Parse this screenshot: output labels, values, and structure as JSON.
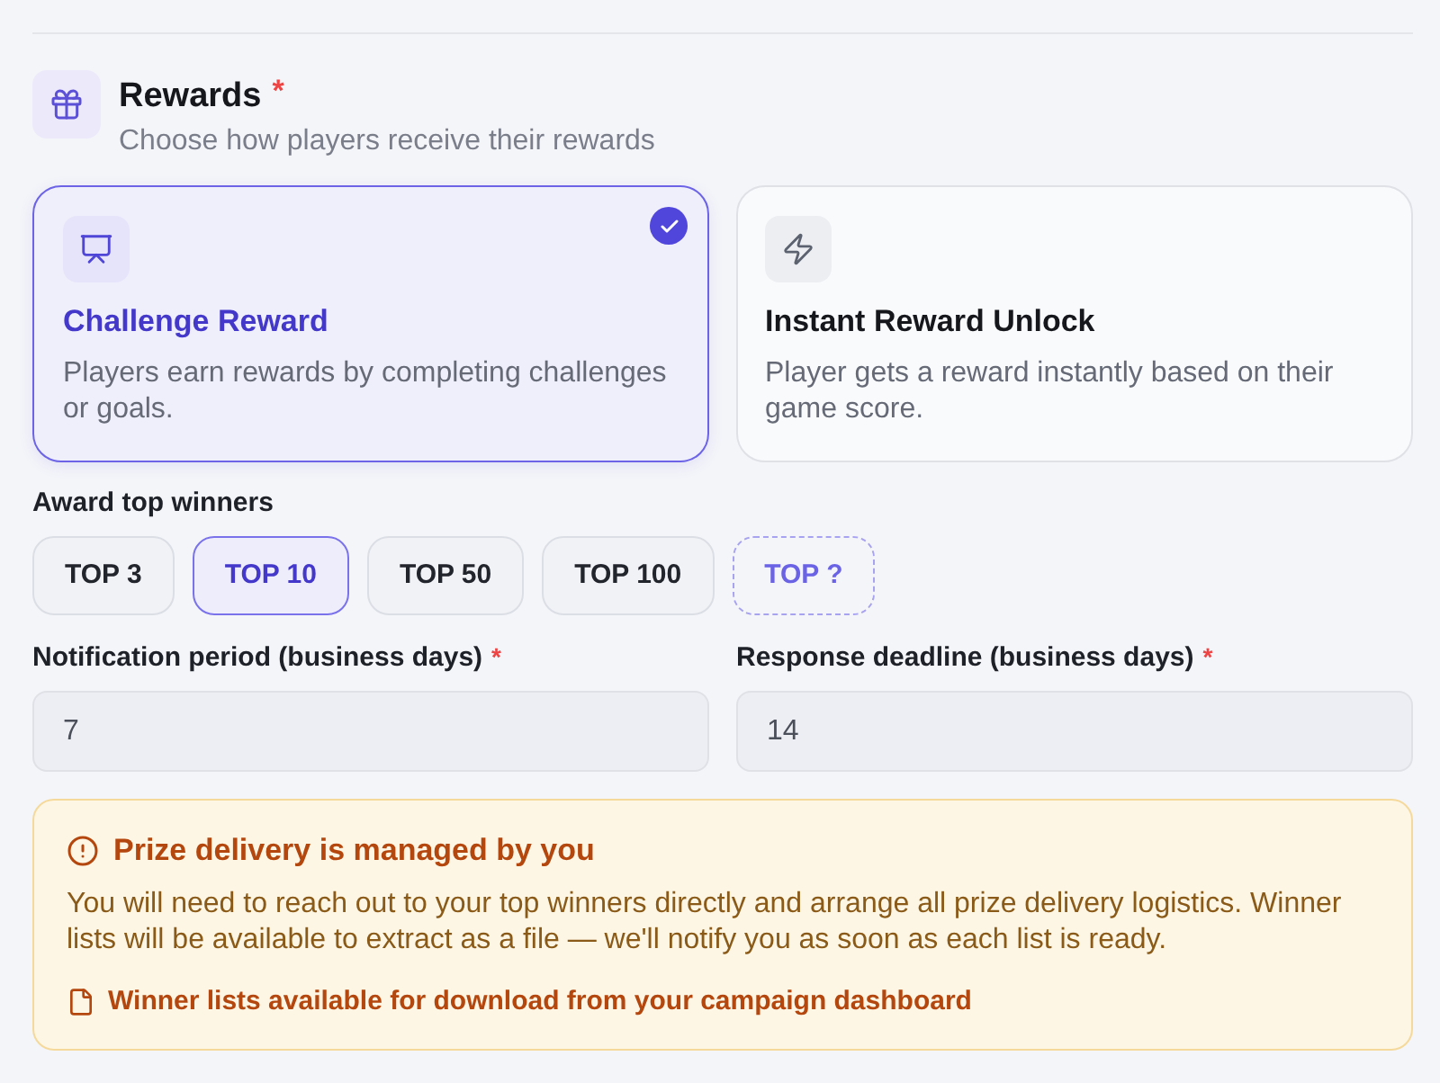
{
  "section": {
    "title": "Rewards",
    "required_mark": "*",
    "subtitle": "Choose how players receive their rewards"
  },
  "reward_types": [
    {
      "title": "Challenge Reward",
      "description": "Players earn rewards by completing challenges or goals.",
      "selected": true
    },
    {
      "title": "Instant Reward Unlock",
      "description": "Player gets a reward instantly based on their game score.",
      "selected": false
    }
  ],
  "award_top_winners": {
    "label": "Award top winners",
    "options": [
      {
        "label": "TOP 3",
        "kind": "preset",
        "selected": false
      },
      {
        "label": "TOP 10",
        "kind": "preset",
        "selected": true
      },
      {
        "label": "TOP 50",
        "kind": "preset",
        "selected": false
      },
      {
        "label": "TOP 100",
        "kind": "preset",
        "selected": false
      },
      {
        "label": "TOP ?",
        "kind": "custom",
        "selected": false
      }
    ]
  },
  "fields": [
    {
      "label": "Notification period (business days)",
      "required_mark": "*",
      "value": "7"
    },
    {
      "label": "Response deadline (business days)",
      "required_mark": "*",
      "value": "14"
    }
  ],
  "notice": {
    "title": "Prize delivery is managed by you",
    "body": "You will need to reach out to your top winners directly and arrange all prize delivery logistics. Winner lists will be available to extract as a file — we'll notify you as soon as each list is ready.",
    "note": "Winner lists available for download from your campaign dashboard"
  }
}
